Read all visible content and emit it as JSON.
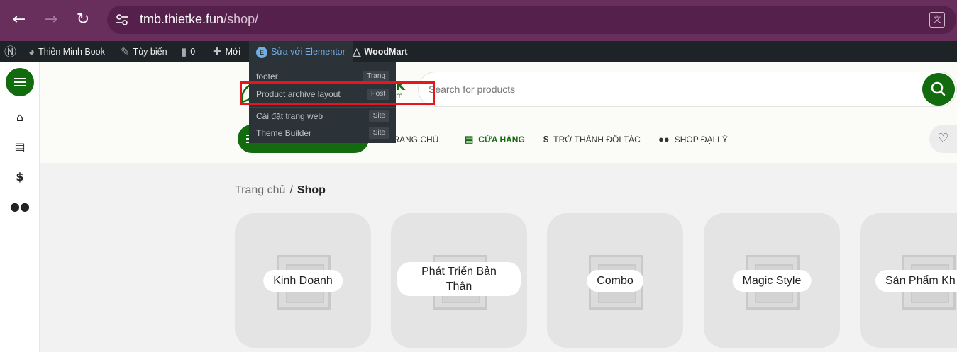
{
  "browser": {
    "url_host": "tmb.thietke.fun",
    "url_path": "/shop/",
    "back_icon": "arrow-left-icon",
    "forward_icon": "arrow-right-icon",
    "reload_icon": "reload-icon"
  },
  "admin_bar": {
    "site_name": "Thiên Minh Book",
    "customize": "Tùy biến",
    "comments_count": "0",
    "new": "Mới",
    "elementor": "Sửa với Elementor",
    "woodmart": "WoodMart"
  },
  "elementor_menu": {
    "items": [
      {
        "label": "footer",
        "badge": "Trang"
      },
      {
        "label": "Product archive layout",
        "badge": "Post"
      },
      {
        "label": "Cài đặt trang web",
        "badge": "Site"
      },
      {
        "label": "Theme Builder",
        "badge": "Site"
      }
    ]
  },
  "header": {
    "logo_text": "K",
    "logo_sub": "m",
    "search_placeholder": "Search for products",
    "nav": [
      {
        "label": "TRANG CHỦ",
        "icon": "home-icon",
        "active": false
      },
      {
        "label": "CỬA HÀNG",
        "icon": "store-icon",
        "active": true
      },
      {
        "label": "TRỞ THÀNH ĐỐI TÁC",
        "icon": "dollar-icon",
        "active": false
      },
      {
        "label": "SHOP ĐẠI LÝ",
        "icon": "users-icon",
        "active": false
      }
    ]
  },
  "breadcrumb": {
    "home": "Trang chủ",
    "separator": "/",
    "current": "Shop"
  },
  "categories": [
    {
      "label": "Kinh Doanh"
    },
    {
      "label": "Phát Triển Bản Thân"
    },
    {
      "label": "Combo"
    },
    {
      "label": "Magic Style"
    },
    {
      "label": "Sản Phẩm Kh"
    }
  ],
  "colors": {
    "brand": "#126b0f",
    "highlight": "#e8151f",
    "browser": "#682f5d",
    "admin_bar": "#1d2327"
  }
}
